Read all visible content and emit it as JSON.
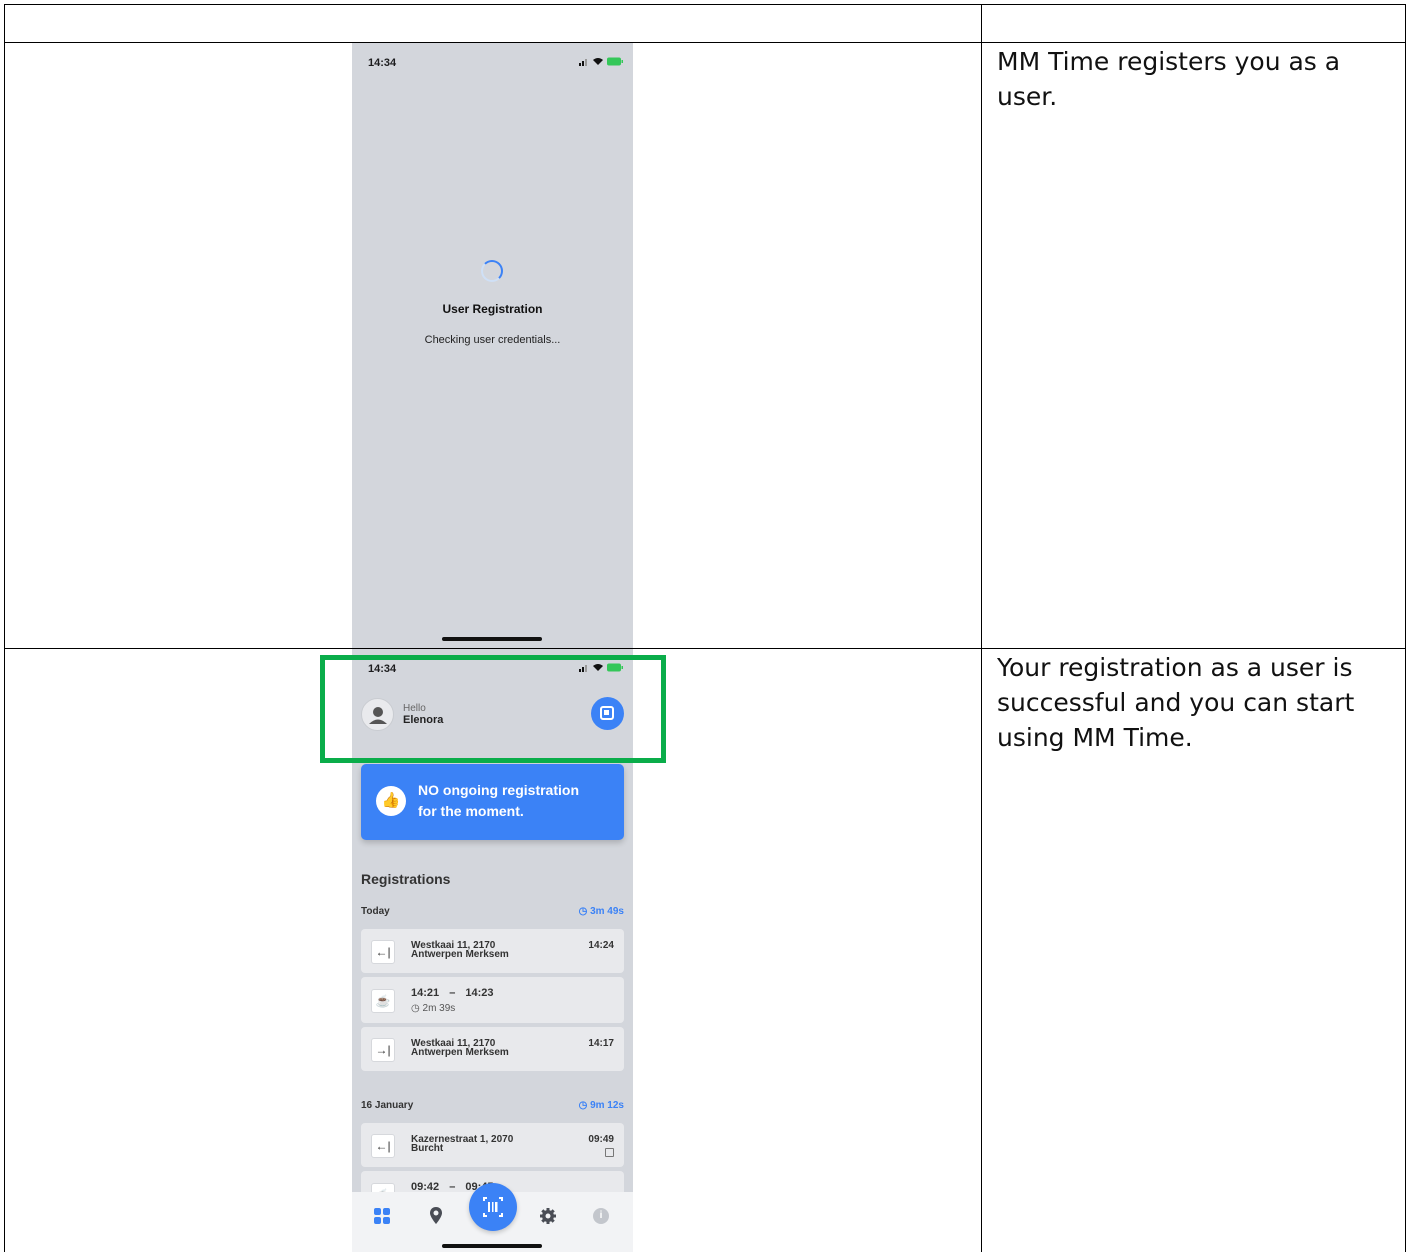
{
  "rows": [
    {
      "description": "MM Time registers you as a user.",
      "screen1": {
        "status_time": "14:34",
        "title": "User Registration",
        "subtitle": "Checking user credentials..."
      }
    },
    {
      "description": "Your registration as a user is successful and you can start using MM Time.",
      "screen2": {
        "status_time": "14:34",
        "greeting": "Hello",
        "user_name": "Elenora",
        "banner_line1": "NO ongoing registration",
        "banner_line2": "for the moment.",
        "section_title": "Registrations",
        "today_label": "Today",
        "today_total": "3m 49s",
        "today_items": [
          {
            "addr1": "Westkaai 11, 2170",
            "addr2": "Antwerpen Merksem",
            "time": "14:24"
          },
          {
            "start": "14:21",
            "dash": "–",
            "end": "14:23",
            "duration": "2m 39s"
          },
          {
            "addr1": "Westkaai 11, 2170",
            "addr2": "Antwerpen Merksem",
            "time": "14:17"
          }
        ],
        "day2_label": "16 January",
        "day2_total": "9m 12s",
        "day2_items": [
          {
            "addr1": "Kazernestraat 1, 2070",
            "addr2": "Burcht",
            "time": "09:49"
          },
          {
            "start": "09:42",
            "dash": "–",
            "end": "09:45"
          }
        ]
      }
    }
  ],
  "colors": {
    "accent": "#3b82f6",
    "highlight_box": "#0aad4a",
    "phone_bg": "#d3d6dc"
  }
}
